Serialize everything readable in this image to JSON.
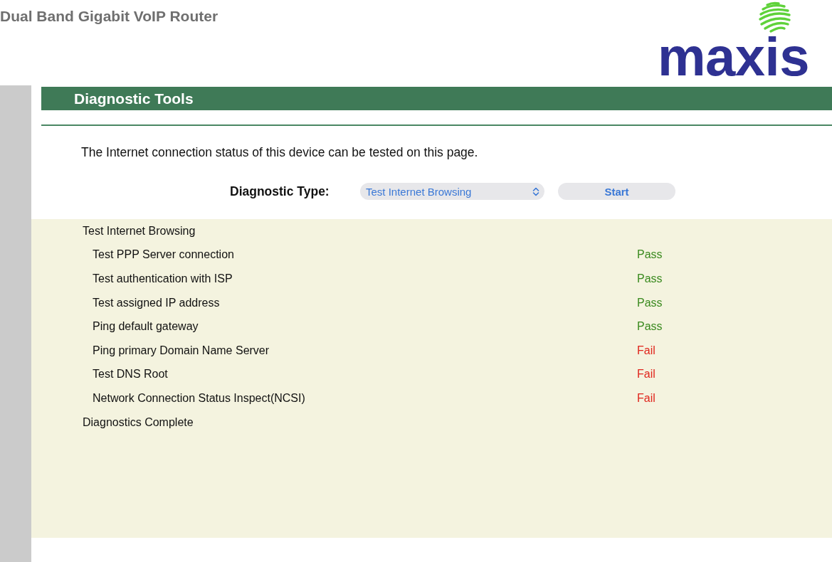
{
  "header": {
    "title": "Dual Band Gigabit VoIP Router",
    "logo_text": "maxis"
  },
  "section": {
    "title": "Diagnostic Tools",
    "description": "The Internet connection status of this device can be tested on this page.",
    "diagnostic_type": {
      "label": "Diagnostic Type:",
      "value": "Test Internet Browsing"
    },
    "start_button": "Start"
  },
  "results": {
    "heading": "Test Internet Browsing",
    "tests": [
      {
        "name": "Test PPP Server connection",
        "result": "Pass",
        "passed": true
      },
      {
        "name": "Test authentication with ISP",
        "result": "Pass",
        "passed": true
      },
      {
        "name": "Test assigned IP address",
        "result": "Pass",
        "passed": true
      },
      {
        "name": "Ping default gateway",
        "result": "Pass",
        "passed": true
      },
      {
        "name": "Ping primary Domain Name Server",
        "result": "Fail",
        "passed": false
      },
      {
        "name": "Test DNS Root",
        "result": "Fail",
        "passed": false
      },
      {
        "name": "Network Connection Status Inspect(NCSI)",
        "result": "Fail",
        "passed": false
      }
    ],
    "footer": "Diagnostics Complete"
  }
}
